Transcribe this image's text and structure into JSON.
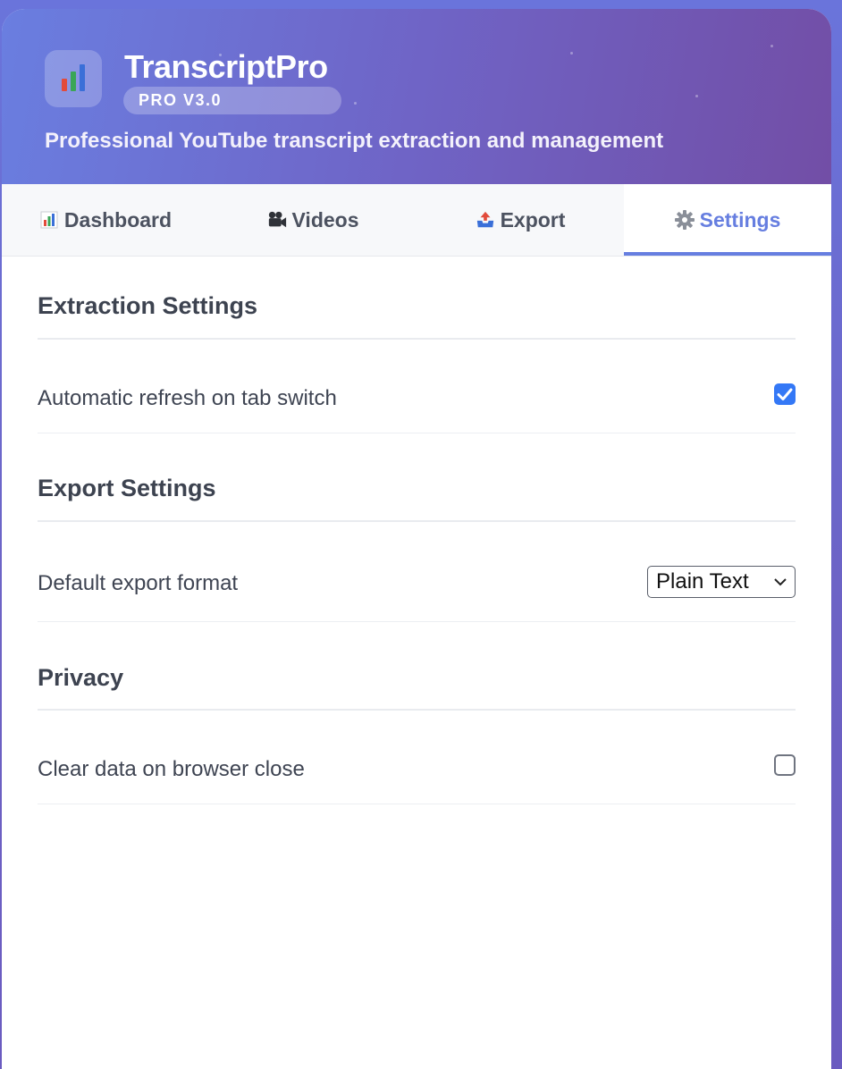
{
  "app": {
    "title": "TranscriptPro",
    "version": "PRO V3.0",
    "subtitle": "Professional YouTube transcript extraction and management",
    "icon": "bar-chart-icon"
  },
  "tabs": [
    {
      "label": "Dashboard",
      "icon": "bar-chart-icon",
      "active": false
    },
    {
      "label": "Videos",
      "icon": "movie-camera-icon",
      "active": false
    },
    {
      "label": "Export",
      "icon": "outbox-tray-icon",
      "active": false
    },
    {
      "label": "Settings",
      "icon": "gear-icon",
      "active": true
    }
  ],
  "settings": {
    "extraction": {
      "title": "Extraction Settings",
      "auto_refresh_label": "Automatic refresh on tab switch",
      "auto_refresh_checked": true
    },
    "export": {
      "title": "Export Settings",
      "default_format_label": "Default export format",
      "default_format_value": "Plain Text"
    },
    "privacy": {
      "title": "Privacy",
      "clear_data_label": "Clear data on browser close",
      "clear_data_checked": false
    }
  },
  "colors": {
    "accent": "#667ee0",
    "checkbox": "#3478f6",
    "header_start": "#6a7ee0",
    "header_end": "#724ea6"
  }
}
